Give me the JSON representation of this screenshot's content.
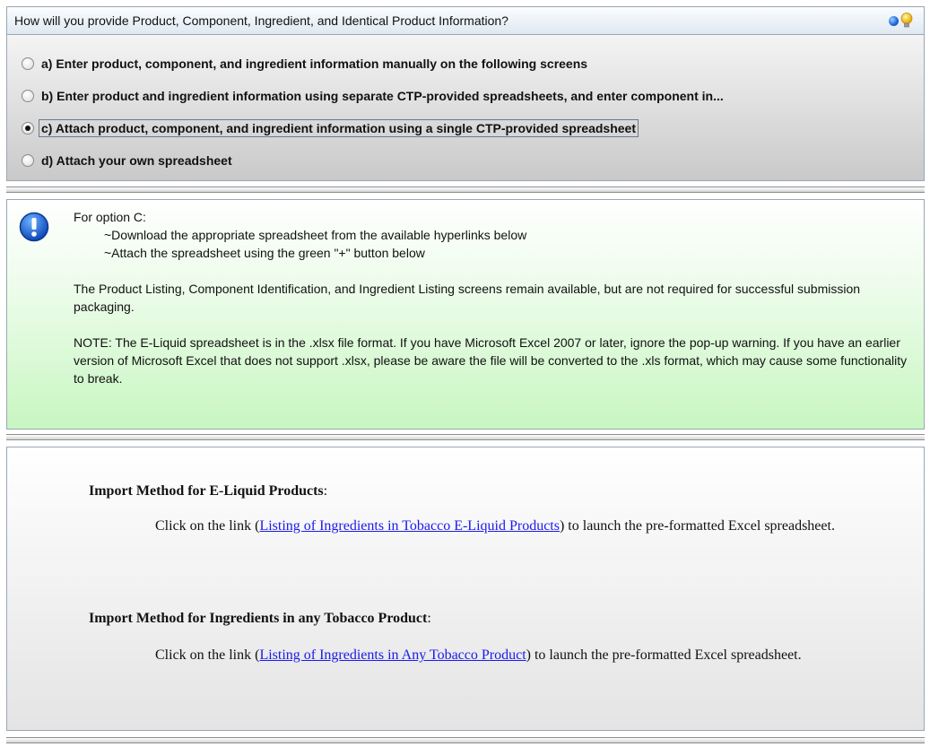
{
  "question": {
    "text": "How will you provide Product, Component, Ingredient, and Identical Product Information?",
    "icons": [
      "help-dot-icon",
      "lightbulb-icon"
    ]
  },
  "options": [
    {
      "label": "a) Enter product, component, and ingredient information manually on the following screens",
      "selected": false
    },
    {
      "label": "b) Enter product and ingredient information using separate CTP-provided spreadsheets, and enter component in...",
      "selected": false
    },
    {
      "label": "c) Attach product, component, and ingredient information using a single CTP-provided spreadsheet",
      "selected": true
    },
    {
      "label": "d) Attach your own spreadsheet",
      "selected": false
    }
  ],
  "info": {
    "heading": "For option C:",
    "step1": "~Download the appropriate spreadsheet from the available hyperlinks below",
    "step2": "~Attach the spreadsheet using the green \"+\" button below",
    "para1": "The Product Listing, Component Identification, and Ingredient Listing screens remain available, but are not required for successful submission packaging.",
    "note": "NOTE: The E-Liquid spreadsheet is in the .xlsx file format. If you have Microsoft Excel 2007 or later, ignore the pop-up warning. If you have an earlier version of Microsoft Excel that does not support .xlsx, please be aware the file will be converted to the .xls format, which may cause some functionality to break."
  },
  "import": {
    "eliquid": {
      "heading": "Import Method for E-Liquid Products",
      "colon": ":",
      "pre": "Click on the link (",
      "link": "Listing of Ingredients in Tobacco E-Liquid Products",
      "post": ") to launch the pre-formatted Excel spreadsheet."
    },
    "any": {
      "heading": "Import Method for Ingredients in any Tobacco Product",
      "colon": ":",
      "pre": "Click on the link (",
      "link": "Listing of Ingredients in Any Tobacco Product",
      "post": ") to launch the pre-formatted Excel spreadsheet."
    }
  }
}
